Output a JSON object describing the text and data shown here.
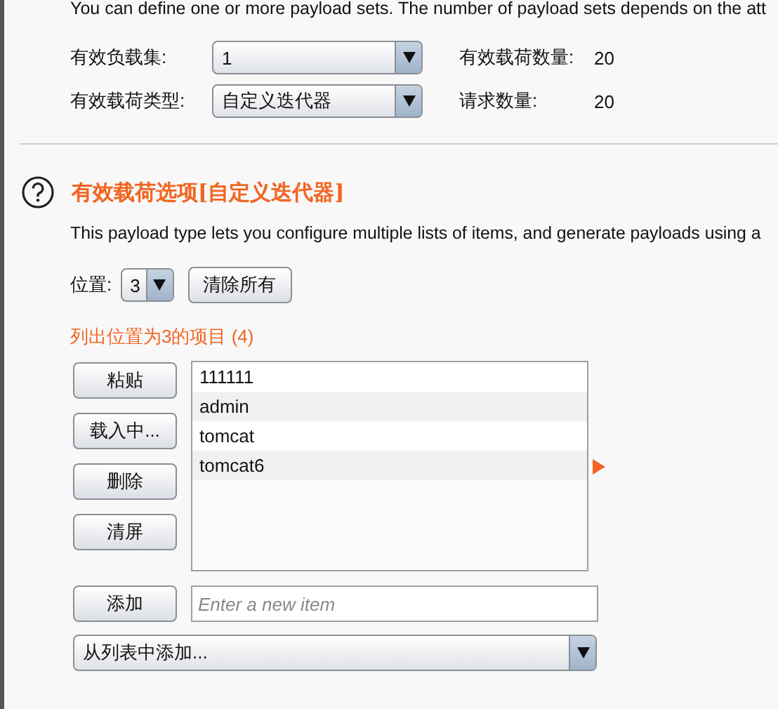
{
  "intro": "You can define one or more payload sets. The number of payload sets depends on the att",
  "settings": [
    {
      "label": "有效负载集:",
      "value": "1",
      "info_label": "有效载荷数量:",
      "info_value": "20"
    },
    {
      "label": "有效载荷类型:",
      "value": "自定义迭代器",
      "info_label": "请求数量:",
      "info_value": "20"
    }
  ],
  "options": {
    "title": "有效载荷选项[自定义迭代器]",
    "description": "This payload type lets you configure multiple lists of items, and generate payloads using a",
    "position_label": "位置:",
    "position_value": "3",
    "clear_all_button": "清除所有",
    "list_heading": "列出位置为3的项目 (4)",
    "buttons": [
      "粘贴",
      "载入中...",
      "删除",
      "清屏"
    ],
    "items": [
      {
        "text": "111111"
      },
      {
        "text": "admin"
      },
      {
        "text": "tomcat"
      },
      {
        "text": "tomcat6"
      }
    ],
    "add_button": "添加",
    "add_placeholder": "Enter a new item",
    "add_from_list": "从列表中添加..."
  }
}
